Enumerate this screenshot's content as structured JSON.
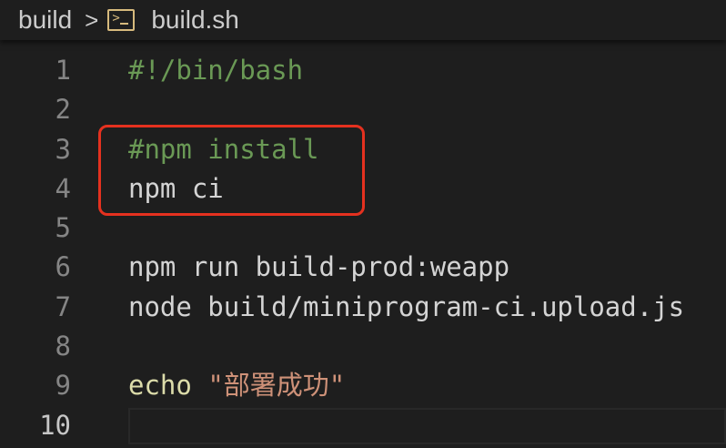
{
  "breadcrumb": {
    "folder": "build",
    "separator": ">",
    "file_icon": "terminal-icon",
    "file": "build.sh"
  },
  "editor": {
    "active_line": 10,
    "lines": [
      {
        "number": "1",
        "tokens": [
          {
            "text": "#!/bin/bash",
            "kind": "comment"
          }
        ]
      },
      {
        "number": "2",
        "tokens": []
      },
      {
        "number": "3",
        "tokens": [
          {
            "text": "#npm install",
            "kind": "comment"
          }
        ]
      },
      {
        "number": "4",
        "tokens": [
          {
            "text": "npm ci",
            "kind": "plain"
          }
        ]
      },
      {
        "number": "5",
        "tokens": []
      },
      {
        "number": "6",
        "tokens": [
          {
            "text": "npm run build-prod:weapp",
            "kind": "plain"
          }
        ]
      },
      {
        "number": "7",
        "tokens": [
          {
            "text": "node build/miniprogram-ci.upload.js",
            "kind": "plain"
          }
        ]
      },
      {
        "number": "8",
        "tokens": []
      },
      {
        "number": "9",
        "tokens": [
          {
            "text": "echo",
            "kind": "func"
          },
          {
            "text": " ",
            "kind": "plain"
          },
          {
            "text": "\"部署成功\"",
            "kind": "string"
          }
        ]
      },
      {
        "number": "10",
        "tokens": []
      }
    ]
  },
  "colors": {
    "background": "#1e1e1e",
    "comment": "#6a9955",
    "plain": "#d4d4d4",
    "func": "#dcdcaa",
    "string": "#ce9178",
    "annotation": "#e5311f"
  }
}
